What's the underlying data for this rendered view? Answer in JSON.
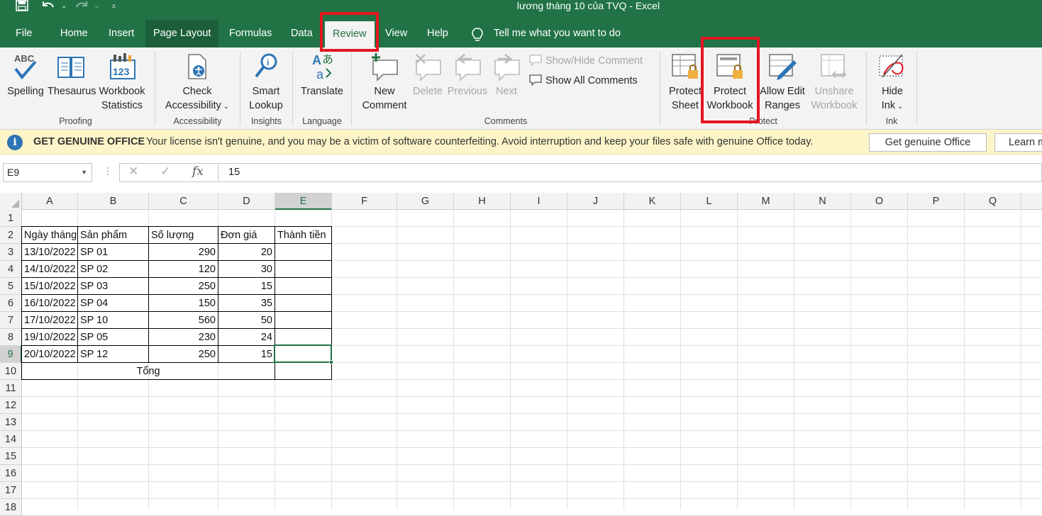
{
  "window": {
    "title": "lương tháng 10 của TVQ  -  Excel"
  },
  "tabs": [
    "File",
    "Home",
    "Insert",
    "Page Layout",
    "Formulas",
    "Data",
    "Review",
    "View",
    "Help"
  ],
  "active_tab": "Review",
  "tell_me": "Tell me what you want to do",
  "ribbon": {
    "proofing": {
      "spelling": "Spelling",
      "thesaurus": "Thesaurus",
      "workbook": "Workbook",
      "statistics": "Statistics",
      "group": "Proofing"
    },
    "accessibility": {
      "check": "Check",
      "accessibility": "Accessibility",
      "group": "Accessibility"
    },
    "insights": {
      "smart": "Smart",
      "lookup": "Lookup",
      "group": "Insights"
    },
    "language": {
      "translate": "Translate",
      "group": "Language"
    },
    "comments": {
      "new": "New",
      "comment": "Comment",
      "delete": "Delete",
      "previous": "Previous",
      "next": "Next",
      "show_hide": "Show/Hide Comment",
      "show_all": "Show All Comments",
      "group": "Comments"
    },
    "protect": {
      "protect1": "Protect",
      "sheet": "Sheet",
      "protect2": "Protect",
      "workbook": "Workbook",
      "allow_edit": "Allow Edit",
      "ranges": "Ranges",
      "unshare": "Unshare",
      "unshare_workbook": "Workbook",
      "group": "Protect"
    },
    "ink": {
      "hide": "Hide",
      "ink": "Ink",
      "group": "Ink"
    }
  },
  "message_bar": {
    "title": "GET GENUINE OFFICE",
    "text": "Your license isn't genuine, and you may be a victim of software counterfeiting. Avoid interruption and keep your files safe with genuine Office today.",
    "button_get": "Get genuine Office",
    "button_learn": "Learn m"
  },
  "formula_bar": {
    "name_box": "E9",
    "value": "15"
  },
  "columns": [
    "A",
    "B",
    "C",
    "D",
    "E",
    "F",
    "G",
    "H",
    "I",
    "J",
    "K",
    "L",
    "M",
    "N",
    "O",
    "P",
    "Q"
  ],
  "rows": [
    "1",
    "2",
    "3",
    "4",
    "5",
    "6",
    "7",
    "8",
    "9",
    "10",
    "11",
    "12",
    "13",
    "14",
    "15",
    "16",
    "17",
    "18"
  ],
  "table": {
    "headers": [
      "Ngày tháng",
      "Sản phẩm",
      "Số lượng",
      "Đơn giá",
      "Thành tiền"
    ],
    "rows": [
      [
        "13/10/2022",
        "SP 01",
        "290",
        "20",
        ""
      ],
      [
        "14/10/2022",
        "SP 02",
        "120",
        "30",
        ""
      ],
      [
        "15/10/2022",
        "SP 03",
        "250",
        "15",
        ""
      ],
      [
        "16/10/2022",
        "SP 04",
        "150",
        "35",
        ""
      ],
      [
        "17/10/2022",
        "SP 10",
        "560",
        "50",
        ""
      ],
      [
        "19/10/2022",
        "SP 05",
        "230",
        "24",
        ""
      ],
      [
        "20/10/2022",
        "SP 12",
        "250",
        "15",
        ""
      ]
    ],
    "total_label": "Tổng"
  },
  "colors": {
    "excel_green": "#217346",
    "highlight_red": "#e3161f"
  }
}
